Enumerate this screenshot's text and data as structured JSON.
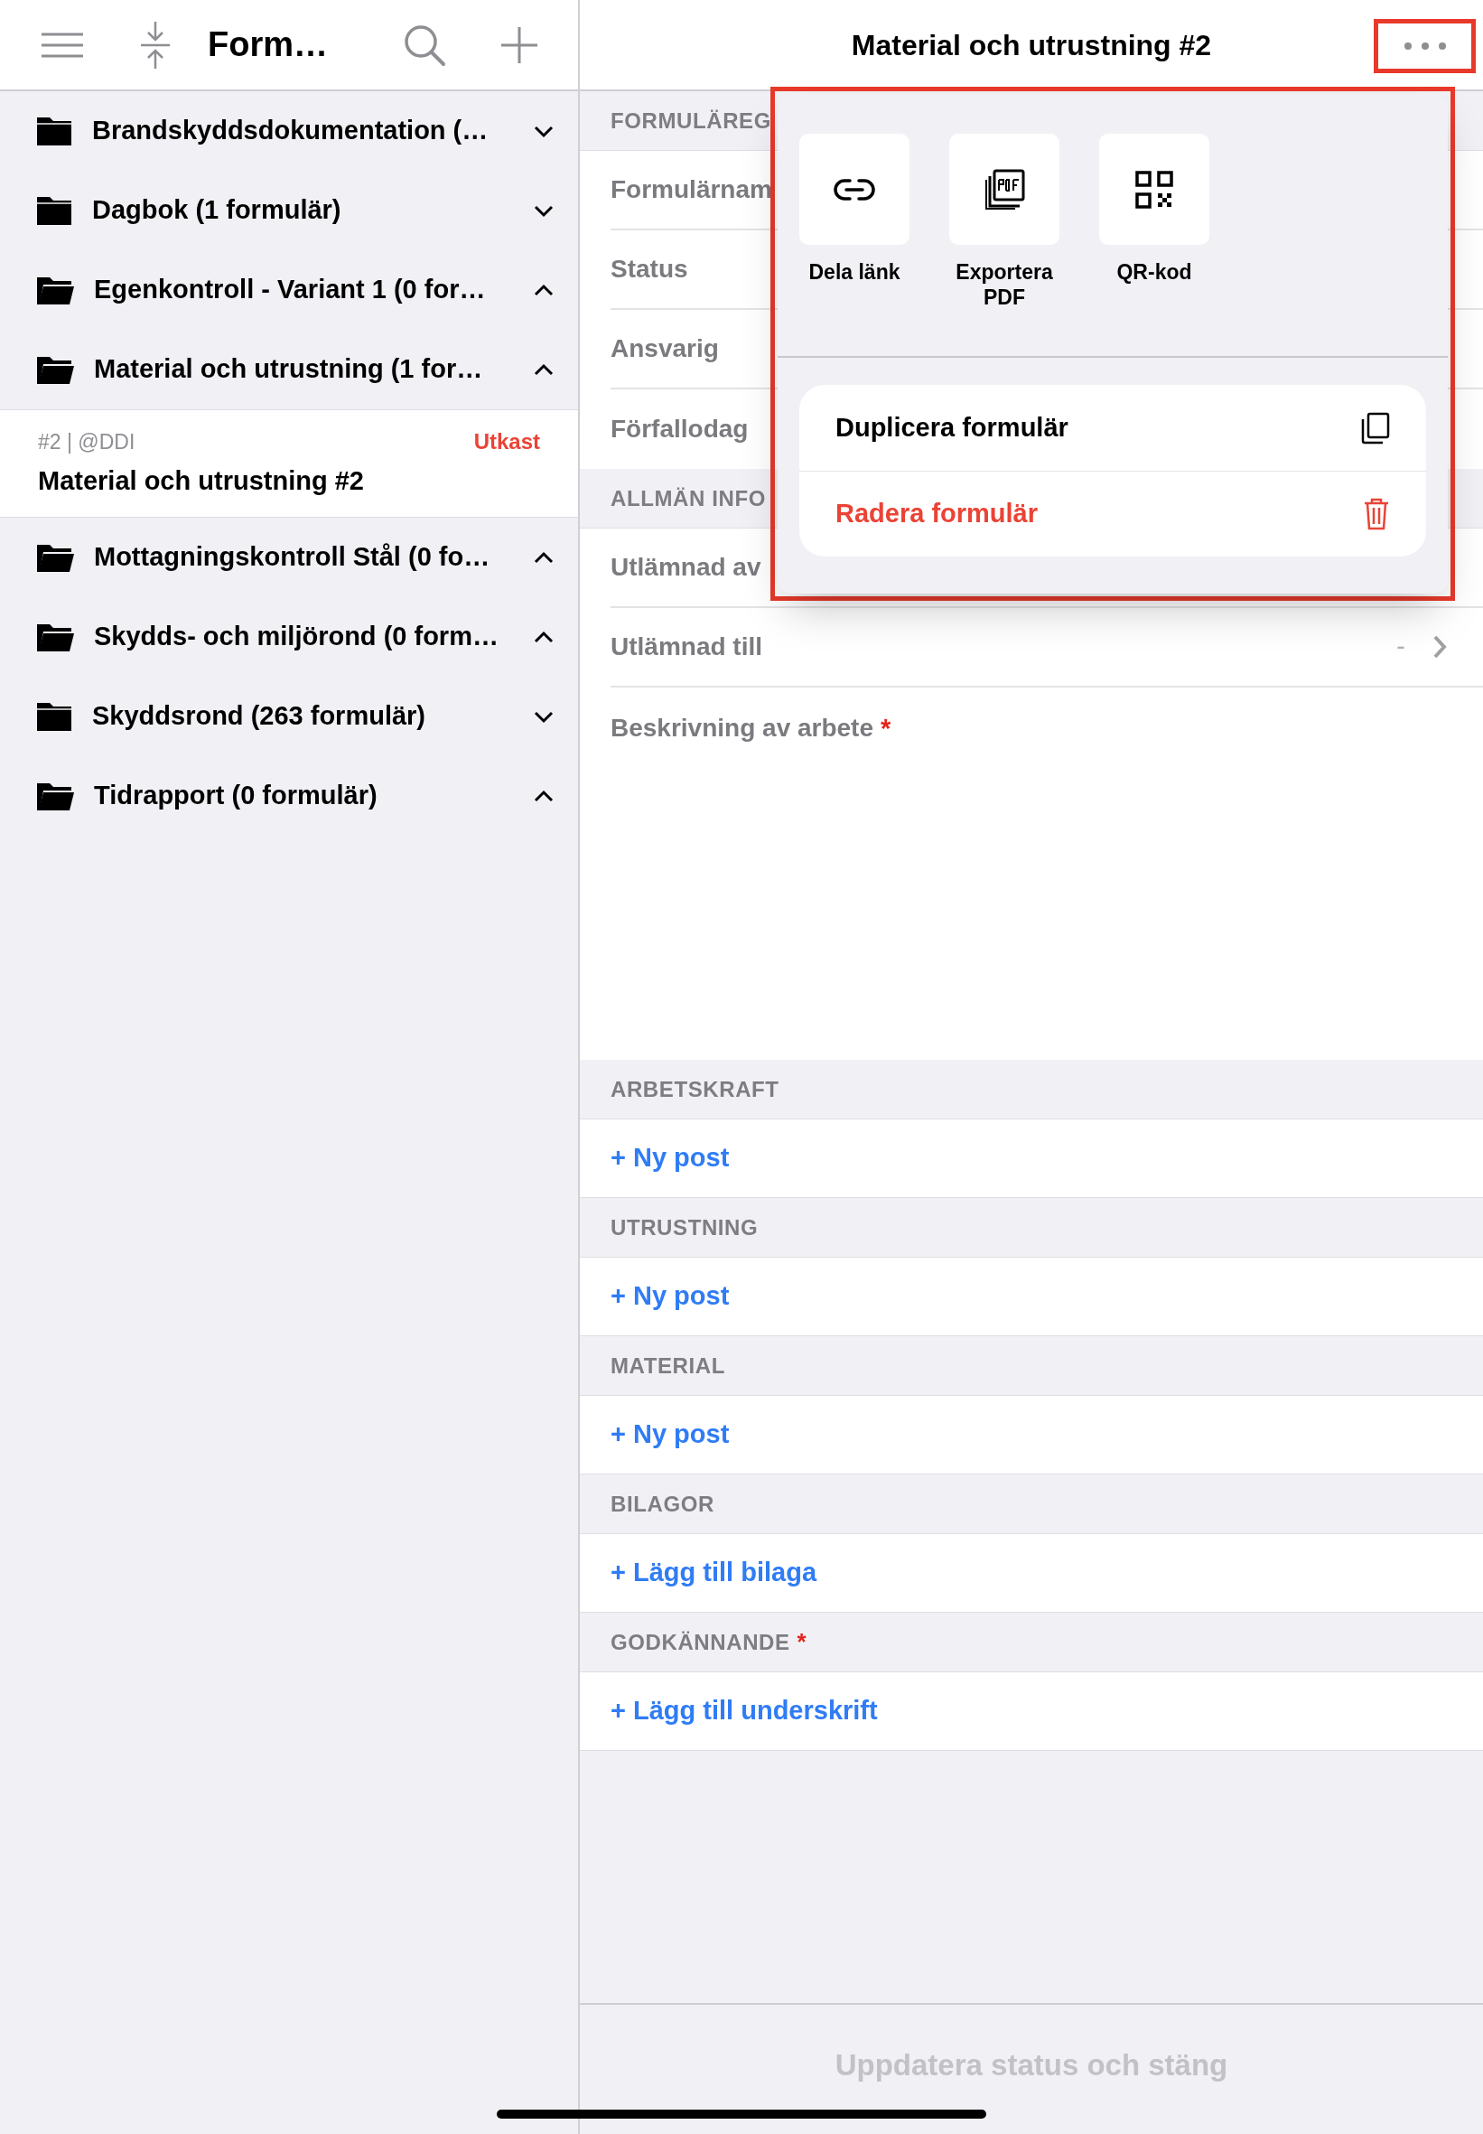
{
  "sidebar": {
    "title": "Form…",
    "folders": [
      {
        "label": "Brandskyddsdokumentation  (…",
        "expanded": false
      },
      {
        "label": "Dagbok (1 formulär)",
        "expanded": false
      },
      {
        "label": "Egenkontroll - Variant 1 (0 for…",
        "expanded": true
      },
      {
        "label": "Material och utrustning (1 for…",
        "expanded": true,
        "children": [
          {
            "meta": "#2 | @DDI",
            "status": "Utkast",
            "title": "Material och utrustning #2",
            "selected": true
          }
        ]
      },
      {
        "label": "Mottagningskontroll Stål (0 fo…",
        "expanded": true
      },
      {
        "label": "Skydds- och miljörond (0 form…",
        "expanded": true
      },
      {
        "label": "Skyddsrond (263 formulär)",
        "expanded": false
      },
      {
        "label": "Tidrapport (0 formulär)",
        "expanded": true
      }
    ]
  },
  "form": {
    "title": "Material och utrustning #2",
    "sections": [
      {
        "heading": "FORMULÄREG",
        "rows": [
          {
            "kind": "field",
            "label": "Formulärnam"
          },
          {
            "kind": "field",
            "label": "Status"
          },
          {
            "kind": "field",
            "label": "Ansvarig"
          },
          {
            "kind": "field",
            "label": "Förfallodag"
          }
        ]
      },
      {
        "heading": "ALLMÄN INFO",
        "rows": [
          {
            "kind": "field",
            "label": "Utlämnad av"
          },
          {
            "kind": "field",
            "label": "Utlämnad till",
            "value": "-"
          },
          {
            "kind": "textarea",
            "label": "Beskrivning av arbete",
            "required_mark": "*"
          }
        ]
      },
      {
        "heading": "ARBETSKRAFT",
        "rows": [
          {
            "kind": "add",
            "label": "+ Ny post"
          }
        ]
      },
      {
        "heading": "UTRUSTNING",
        "rows": [
          {
            "kind": "add",
            "label": "+ Ny post"
          }
        ]
      },
      {
        "heading": "MATERIAL",
        "rows": [
          {
            "kind": "add",
            "label": "+ Ny post"
          }
        ]
      },
      {
        "heading": "BILAGOR",
        "rows": [
          {
            "kind": "add",
            "label": "+ Lägg till bilaga"
          }
        ]
      },
      {
        "heading": "GODKÄNNANDE",
        "required_mark": "*",
        "rows": [
          {
            "kind": "add",
            "label": "+ Lägg till underskrift"
          }
        ]
      }
    ],
    "submit": {
      "label": "Uppdatera status och stäng",
      "disabled": true
    }
  },
  "menu": {
    "tiles": [
      {
        "label": "Dela länk"
      },
      {
        "label": "Exportera PDF"
      },
      {
        "label": "QR-kod"
      }
    ],
    "actions": [
      {
        "label": "Duplicera formulär",
        "kind": "normal"
      },
      {
        "label": "Radera formulär",
        "kind": "destructive"
      }
    ]
  }
}
